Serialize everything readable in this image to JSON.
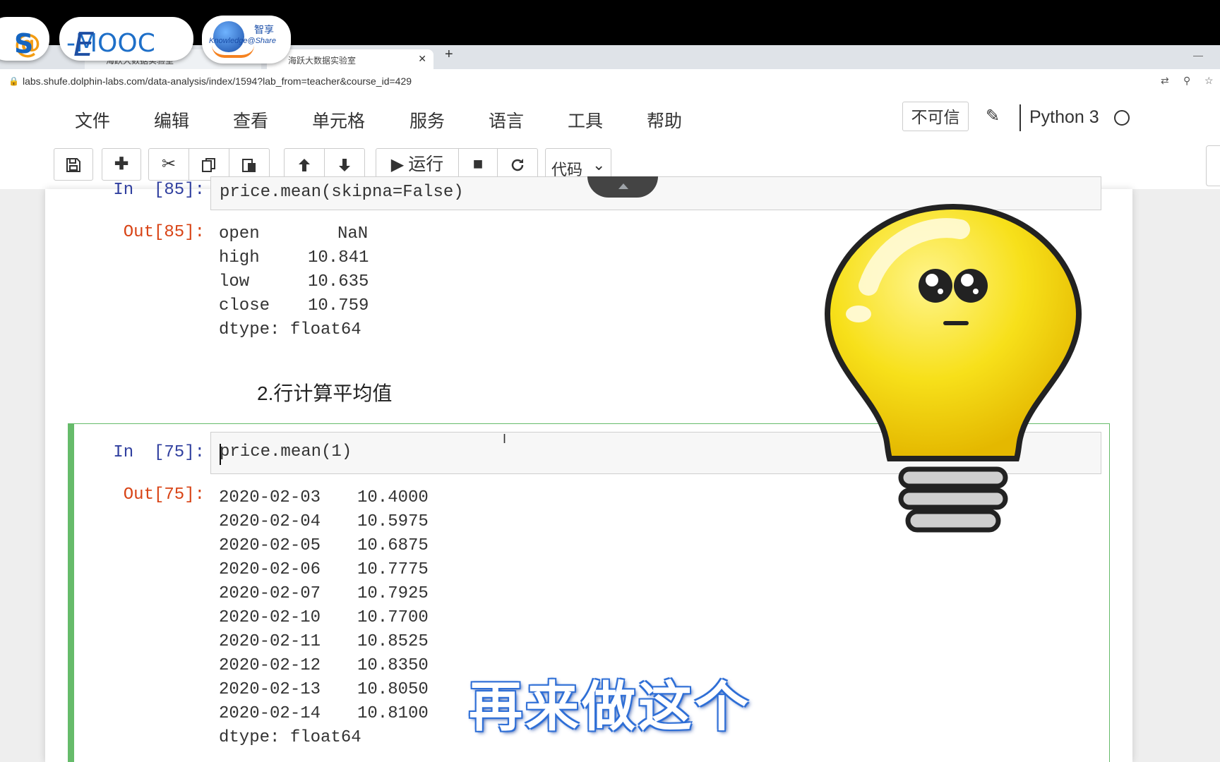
{
  "browser": {
    "tabs": [
      {
        "title": "海跃大数据实验室",
        "active": false
      },
      {
        "title": "海跃大数据实验室",
        "active": true
      }
    ],
    "url": "labs.shufe.dolphin-labs.com/data-analysis/index/1594?lab_from=teacher&course_id=429"
  },
  "logos": {
    "logo1": {
      "at": "@",
      "s": "S"
    },
    "logo2": {
      "e": "E",
      "rest": "-MOOC"
    },
    "logo3": {
      "cn": "智享",
      "en": "Knowledge@Share"
    }
  },
  "menu": {
    "items": [
      "文件",
      "编辑",
      "查看",
      "单元格",
      "服务",
      "语言",
      "工具",
      "帮助"
    ],
    "trust": "不可信",
    "kernel": "Python 3"
  },
  "toolbar": {
    "run_label": "运行",
    "cell_type": "代码"
  },
  "cells": {
    "cell1": {
      "in_prompt": "In  [85]:",
      "code": "price.mean(skipna=False)",
      "out_prompt": "Out[85]:",
      "output": [
        {
          "k": "open",
          "v": "NaN"
        },
        {
          "k": "high",
          "v": "10.841"
        },
        {
          "k": "low",
          "v": "10.635"
        },
        {
          "k": "close",
          "v": "10.759"
        }
      ],
      "dtype": "dtype: float64"
    },
    "markdown_heading": "2.行计算平均值",
    "cell2": {
      "in_prompt": "In  [75]:",
      "code": "price.mean(1)",
      "out_prompt": "Out[75]:",
      "output": [
        {
          "k": "2020-02-03",
          "v": "10.4000"
        },
        {
          "k": "2020-02-04",
          "v": "10.5975"
        },
        {
          "k": "2020-02-05",
          "v": "10.6875"
        },
        {
          "k": "2020-02-06",
          "v": "10.7775"
        },
        {
          "k": "2020-02-07",
          "v": "10.7925"
        },
        {
          "k": "2020-02-10",
          "v": "10.7700"
        },
        {
          "k": "2020-02-11",
          "v": "10.8525"
        },
        {
          "k": "2020-02-12",
          "v": "10.8350"
        },
        {
          "k": "2020-02-13",
          "v": "10.8050"
        },
        {
          "k": "2020-02-14",
          "v": "10.8100"
        }
      ],
      "dtype": "dtype: float64"
    }
  },
  "subtitle": "再来做这个",
  "colors": {
    "selected_cell": "#66bb6a",
    "in_prompt": "#303f9f",
    "out_prompt": "#d84315",
    "bulb": "#f7e01a",
    "subtitle_outline": "#2f6fd6"
  }
}
